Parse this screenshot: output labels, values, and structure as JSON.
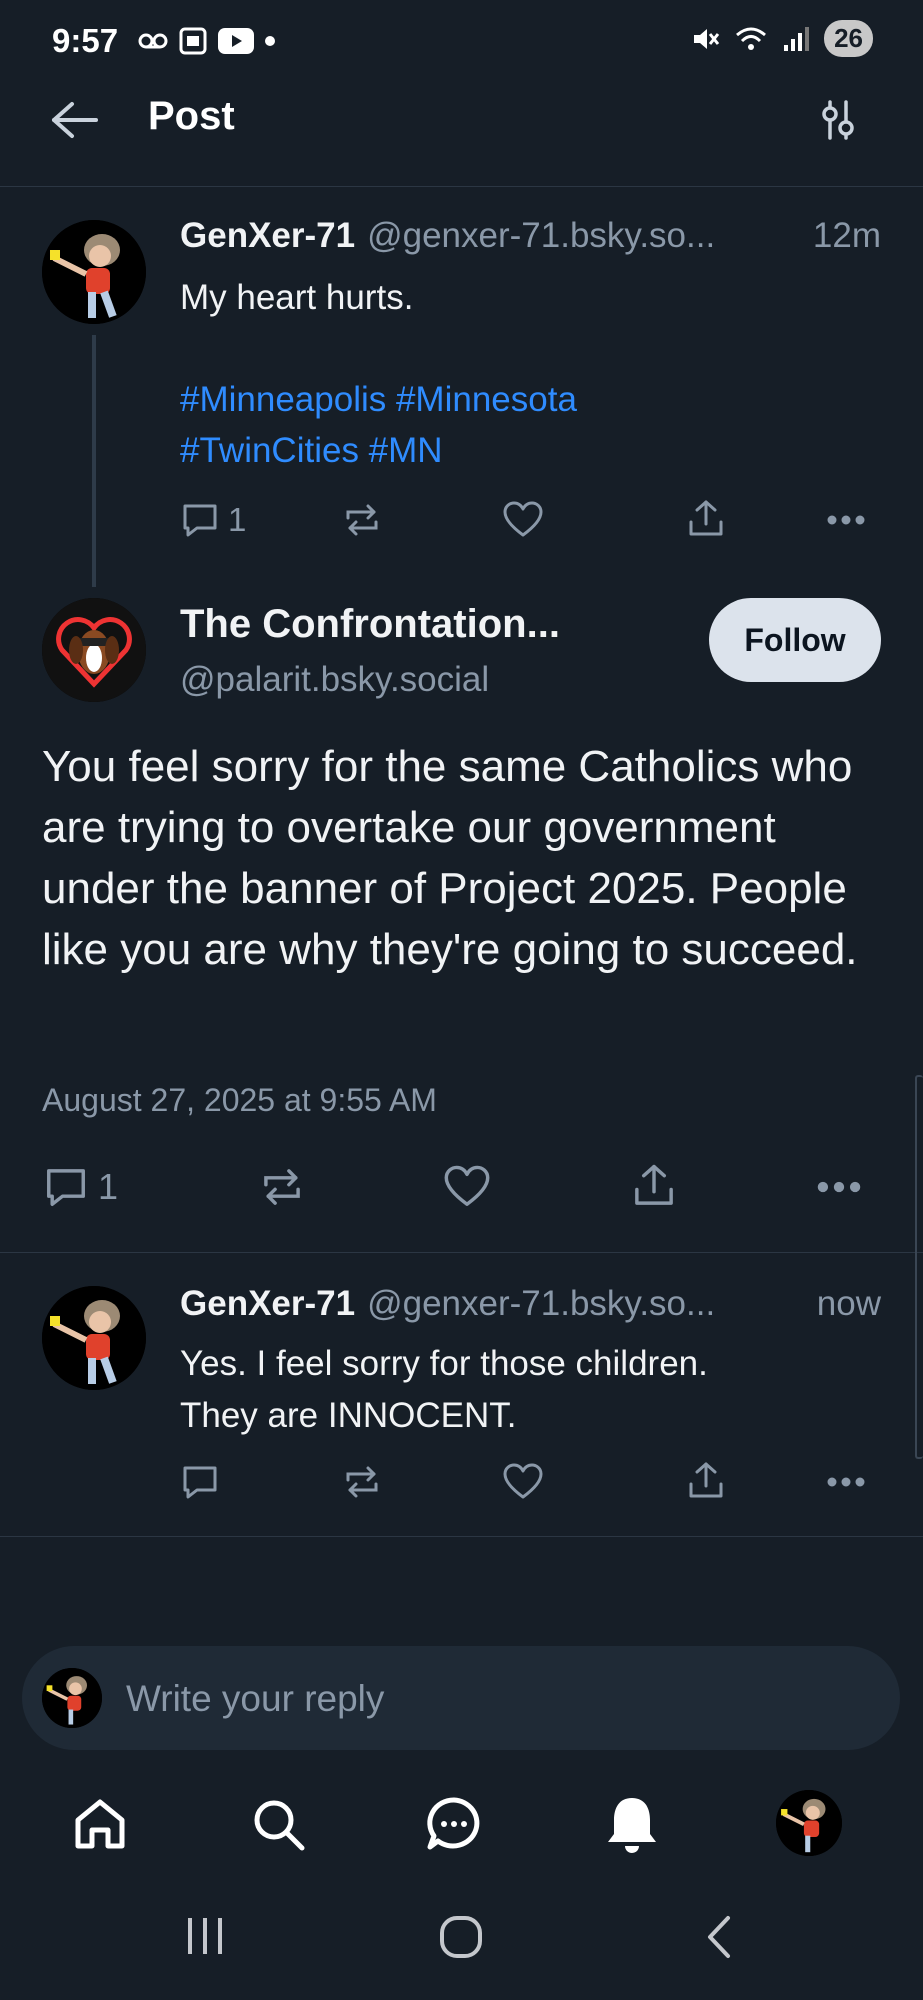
{
  "status_bar": {
    "time": "9:57",
    "battery": "26"
  },
  "header": {
    "title": "Post"
  },
  "parent_post": {
    "author_name": "GenXer-71",
    "author_handle": "@genxer-71.bsky.so...",
    "time_ago": "12m",
    "text": "My heart hurts.",
    "hashtags_line1": "#Minneapolis #Minnesota",
    "hashtags_line2": "#TwinCities #MN",
    "reply_count": "1"
  },
  "main_post": {
    "author_name": "The Confrontation...",
    "author_handle": "@palarit.bsky.social",
    "follow_label": "Follow",
    "text": "You feel sorry for the same Catholics who are trying to overtake our government under the banner of Project 2025. People like you are why they're going to succeed.",
    "date": "August 27, 2025 at 9:55 AM",
    "reply_count": "1"
  },
  "reply_post": {
    "author_name": "GenXer-71",
    "author_handle": "@genxer-71.bsky.so...",
    "time_ago": "now",
    "text_line1": "Yes. I feel sorry for those children.",
    "text_line2": "They are INNOCENT."
  },
  "composer": {
    "placeholder": "Write your reply"
  },
  "icons": {
    "back": "arrow-left-icon",
    "filter": "sliders-icon",
    "reply": "comment-icon",
    "repost": "repost-icon",
    "like": "heart-icon",
    "share": "share-icon",
    "more": "ellipsis-icon"
  },
  "colors": {
    "background": "#161e27",
    "link": "#2f8cff",
    "muted": "#8a98a8"
  }
}
